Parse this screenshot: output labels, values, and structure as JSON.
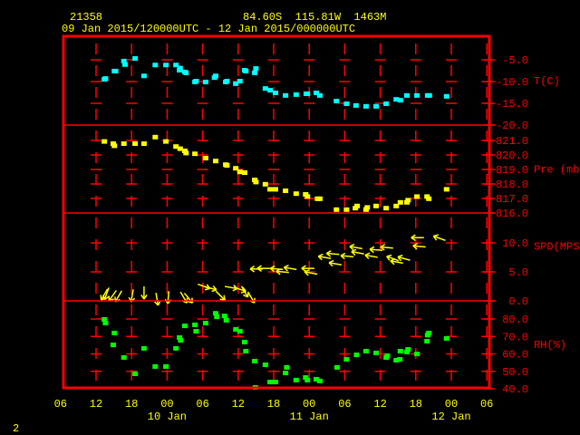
{
  "header": {
    "station_id": "21358",
    "location": "84.60S  115.81W  1463M",
    "period": "09 Jan 2015/120000UTC - 12 Jan 2015/000000UTC"
  },
  "footer": {
    "page_number": "2"
  },
  "colors": {
    "frame": "#ff0000",
    "text": "#ffff00",
    "temperature": "#00ffff",
    "pressure": "#ffff00",
    "wind": "#ffff00",
    "rh": "#00ff00"
  },
  "chart_data": {
    "type": "scatter",
    "title": "21358  84.60S 115.81W 1463M  09 Jan 2015/120000UTC - 12 Jan 2015/000000UTC",
    "x_unit": "hours since 09 Jan 2015 12Z",
    "x_ticks": [
      {
        "h": -6,
        "label": "06"
      },
      {
        "h": 0,
        "label": "12"
      },
      {
        "h": 6,
        "label": "18"
      },
      {
        "h": 12,
        "label": "00"
      },
      {
        "h": 18,
        "label": "06"
      },
      {
        "h": 24,
        "label": "12"
      },
      {
        "h": 30,
        "label": "18"
      },
      {
        "h": 36,
        "label": "00"
      },
      {
        "h": 42,
        "label": "06"
      },
      {
        "h": 48,
        "label": "12"
      },
      {
        "h": 54,
        "label": "18"
      },
      {
        "h": 60,
        "label": "00"
      },
      {
        "h": 66,
        "label": "06"
      }
    ],
    "day_labels": [
      {
        "h": 12,
        "label": "10 Jan"
      },
      {
        "h": 36,
        "label": "11 Jan"
      },
      {
        "h": 60,
        "label": "12 Jan"
      }
    ],
    "xlim": [
      -6,
      66
    ],
    "panels": [
      {
        "name": "temperature",
        "label": "T(C)",
        "ylim": [
          -20,
          -2
        ],
        "ticks": [
          {
            "v": -5,
            "label": "-5.0"
          },
          {
            "v": -10,
            "label": "-10.0"
          },
          {
            "v": -15,
            "label": "-15.0"
          },
          {
            "v": -20,
            "label": "-20.0"
          }
        ],
        "points": [
          [
            1.4,
            -9.6
          ],
          [
            1.6,
            -9.4
          ],
          [
            3.1,
            -7.7
          ],
          [
            3.3,
            -7.7
          ],
          [
            4.7,
            -5.4
          ],
          [
            4.9,
            -6.2
          ],
          [
            6.6,
            -4.8
          ],
          [
            8.1,
            -8.8
          ],
          [
            10,
            -6.3
          ],
          [
            11.8,
            -6.3
          ],
          [
            13.5,
            -6.3
          ],
          [
            14.2,
            -7.0
          ],
          [
            14.1,
            -7.5
          ],
          [
            15,
            -7.9
          ],
          [
            15.2,
            -8.1
          ],
          [
            16.7,
            -10.2
          ],
          [
            16.9,
            -10.0
          ],
          [
            18.5,
            -10.2
          ],
          [
            20.2,
            -8.8
          ],
          [
            20.0,
            -9.2
          ],
          [
            21.9,
            -10.2
          ],
          [
            22.1,
            -10.0
          ],
          [
            23.6,
            -10.6
          ],
          [
            24.3,
            -10.0
          ],
          [
            25.1,
            -7.5
          ],
          [
            25.3,
            -7.7
          ],
          [
            26.8,
            -8.1
          ],
          [
            27.0,
            -7.1
          ],
          [
            28.6,
            -11.7
          ],
          [
            29.4,
            -12.1
          ],
          [
            30.3,
            -12.7
          ],
          [
            32,
            -13.3
          ],
          [
            33.8,
            -13.1
          ],
          [
            35.5,
            -12.9
          ],
          [
            35.7,
            -12.9
          ],
          [
            37.2,
            -12.7
          ],
          [
            37.8,
            -13.3
          ],
          [
            40.6,
            -14.6
          ],
          [
            42.3,
            -15.2
          ],
          [
            43.9,
            -15.6
          ],
          [
            45.6,
            -15.8
          ],
          [
            47.3,
            -15.8
          ],
          [
            49,
            -15.2
          ],
          [
            50.7,
            -14.2
          ],
          [
            51.4,
            -14.4
          ],
          [
            52.5,
            -13.3
          ],
          [
            54.2,
            -13.3
          ],
          [
            56,
            -13.3
          ],
          [
            56.3,
            -13.3
          ],
          [
            59.2,
            -13.5
          ]
        ]
      },
      {
        "name": "pressure",
        "label": "Pre (mb)",
        "ylim": [
          816,
          822.05
        ],
        "ticks": [
          {
            "v": 821,
            "label": "821.0"
          },
          {
            "v": 820,
            "label": "820.0"
          },
          {
            "v": 819,
            "label": "819.0"
          },
          {
            "v": 818,
            "label": "818.0"
          },
          {
            "v": 817,
            "label": "817.0"
          },
          {
            "v": 816,
            "label": "816.0"
          }
        ],
        "points": [
          [
            1.4,
            820.9
          ],
          [
            2.9,
            820.75
          ],
          [
            3.1,
            820.6
          ],
          [
            4.7,
            820.75
          ],
          [
            6.6,
            820.75
          ],
          [
            8.1,
            820.75
          ],
          [
            10,
            821.2
          ],
          [
            11.8,
            820.9
          ],
          [
            13.5,
            820.55
          ],
          [
            14.2,
            820.4
          ],
          [
            15,
            820.25
          ],
          [
            15.2,
            820.1
          ],
          [
            16.7,
            820.05
          ],
          [
            18.5,
            819.75
          ],
          [
            20.2,
            819.55
          ],
          [
            21.9,
            819.3
          ],
          [
            22.1,
            819.25
          ],
          [
            23.6,
            819.05
          ],
          [
            24.3,
            818.8
          ],
          [
            25.1,
            818.75
          ],
          [
            26.8,
            818.25
          ],
          [
            27.0,
            818.1
          ],
          [
            28.6,
            817.95
          ],
          [
            29.4,
            817.6
          ],
          [
            30.3,
            817.6
          ],
          [
            32,
            817.5
          ],
          [
            33.8,
            817.3
          ],
          [
            35.4,
            817.25
          ],
          [
            35.7,
            817.1
          ],
          [
            37.4,
            816.95
          ],
          [
            37.8,
            816.95
          ],
          [
            40.6,
            816.2
          ],
          [
            42.3,
            816.2
          ],
          [
            43.8,
            816.3
          ],
          [
            44.1,
            816.45
          ],
          [
            45.6,
            816.2
          ],
          [
            45.8,
            816.35
          ],
          [
            47.3,
            816.45
          ],
          [
            49,
            816.3
          ],
          [
            50.7,
            816.45
          ],
          [
            51.4,
            816.7
          ],
          [
            52.5,
            816.7
          ],
          [
            52.7,
            816.85
          ],
          [
            54.2,
            817.1
          ],
          [
            55.9,
            817.1
          ],
          [
            56.2,
            816.95
          ],
          [
            59.2,
            817.6
          ]
        ]
      },
      {
        "name": "wind_speed",
        "label": "SPD(MPS)",
        "ylim": [
          0,
          15.15
        ],
        "ticks": [
          {
            "v": 10,
            "label": "10.0"
          },
          {
            "v": 5,
            "label": "5.0"
          },
          {
            "v": 0,
            "label": "0.0"
          }
        ],
        "arrows_note": "each arrow: [hour, speed m/s, screen direction of arrow in degrees, 0=right, 90=down, 180=left]",
        "arrows": [
          [
            1.4,
            1.1,
            120
          ],
          [
            1.8,
            1.25,
            110
          ],
          [
            2.8,
            0.9,
            125
          ],
          [
            3.8,
            0.8,
            120
          ],
          [
            6.1,
            0.9,
            100
          ],
          [
            8.1,
            1.4,
            90
          ],
          [
            10.3,
            0.3,
            80
          ],
          [
            12.2,
            0.6,
            95
          ],
          [
            14.8,
            0.6,
            60
          ],
          [
            15.6,
            0.5,
            50
          ],
          [
            18.2,
            2.5,
            20
          ],
          [
            19.3,
            2.2,
            15
          ],
          [
            21,
            0.9,
            45
          ],
          [
            22.8,
            2.3,
            10
          ],
          [
            24.3,
            2.0,
            20
          ],
          [
            25.1,
            1.6,
            60
          ],
          [
            26.2,
            0.6,
            60
          ],
          [
            27.1,
            5.5,
            180
          ],
          [
            28.3,
            5.6,
            180
          ],
          [
            30.5,
            5.5,
            185
          ],
          [
            31.5,
            5.0,
            185
          ],
          [
            32.8,
            5.6,
            190
          ],
          [
            35.8,
            5.6,
            180
          ],
          [
            36.3,
            4.8,
            190
          ],
          [
            38.6,
            7.5,
            190
          ],
          [
            40,
            8.1,
            185
          ],
          [
            40.4,
            6.4,
            190
          ],
          [
            42.4,
            7.7,
            185
          ],
          [
            43.9,
            9.2,
            190
          ],
          [
            44.2,
            8.3,
            190
          ],
          [
            46.5,
            7.7,
            190
          ],
          [
            47.3,
            8.8,
            185
          ],
          [
            49.1,
            9.2,
            185
          ],
          [
            50.1,
            7.3,
            200
          ],
          [
            50.8,
            6.7,
            190
          ],
          [
            52,
            7.3,
            195
          ],
          [
            54.3,
            10.9,
            180
          ],
          [
            54.6,
            9.4,
            185
          ],
          [
            58,
            10.8,
            200
          ]
        ]
      },
      {
        "name": "relative_humidity",
        "label": "RH(%)",
        "ylim": [
          40.5,
          90.5
        ],
        "ticks": [
          {
            "v": 80,
            "label": "80.0"
          },
          {
            "v": 70,
            "label": "70.0"
          },
          {
            "v": 60,
            "label": "60.0"
          },
          {
            "v": 50,
            "label": "50.0"
          },
          {
            "v": 40,
            "label": "40.0"
          }
        ],
        "points": [
          [
            1.4,
            79.5
          ],
          [
            1.6,
            77.4
          ],
          [
            3.1,
            71.7
          ],
          [
            2.9,
            64.9
          ],
          [
            4.7,
            57.7
          ],
          [
            6.6,
            48.3
          ],
          [
            8.1,
            62.9
          ],
          [
            10,
            52.5
          ],
          [
            11.8,
            52.5
          ],
          [
            13.5,
            62.9
          ],
          [
            14.1,
            69.1
          ],
          [
            14.3,
            67.5
          ],
          [
            15,
            75.8
          ],
          [
            16.7,
            76.4
          ],
          [
            16.9,
            72.7
          ],
          [
            18.5,
            77.4
          ],
          [
            20.2,
            83
          ],
          [
            20.4,
            81
          ],
          [
            21.7,
            81.5
          ],
          [
            22.0,
            79
          ],
          [
            23.6,
            73.8
          ],
          [
            24.3,
            72.7
          ],
          [
            25.1,
            66.5
          ],
          [
            25.3,
            61.3
          ],
          [
            26.8,
            55.6
          ],
          [
            26.9,
            40.5
          ],
          [
            28.6,
            53.5
          ],
          [
            29.4,
            43.6
          ],
          [
            30.3,
            43.6
          ],
          [
            32.2,
            52
          ],
          [
            32.0,
            48.8
          ],
          [
            33.8,
            44.7
          ],
          [
            35.4,
            46.2
          ],
          [
            35.7,
            44.7
          ],
          [
            37.2,
            45.2
          ],
          [
            37.8,
            44.2
          ],
          [
            40.7,
            52
          ],
          [
            42.3,
            56.6
          ],
          [
            44,
            59.2
          ],
          [
            45.6,
            61.3
          ],
          [
            47.3,
            60.3
          ],
          [
            49.2,
            58.7
          ],
          [
            49.0,
            57.7
          ],
          [
            50.7,
            56.1
          ],
          [
            51.3,
            56.6
          ],
          [
            51.4,
            61.3
          ],
          [
            52.7,
            62.3
          ],
          [
            52.5,
            60.8
          ],
          [
            54.2,
            59.7
          ],
          [
            55.9,
            67
          ],
          [
            56.2,
            71.7
          ],
          [
            56.0,
            70.5
          ],
          [
            59.2,
            68.6
          ]
        ]
      }
    ]
  }
}
